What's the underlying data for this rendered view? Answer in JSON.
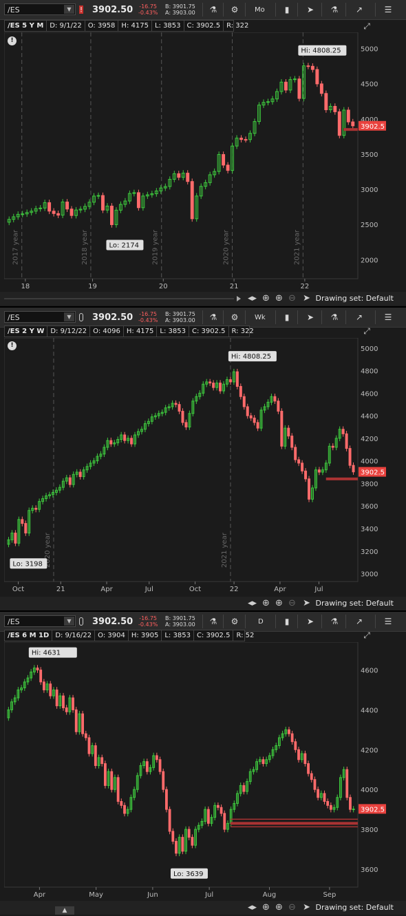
{
  "quote": {
    "price": "3902.50",
    "change": "-16.75",
    "change_pct": "-0.43%",
    "bid": "B: 3901.75",
    "ask": "A: 3903.00"
  },
  "drawing_set_label": "Drawing set: Default",
  "colors": {
    "up": "#3ec93e",
    "down": "#ff6b6b",
    "price_tag": "#e9423e",
    "bg": "#1b1b1b",
    "axis_text": "#bdbdbd"
  },
  "panels": [
    {
      "symbol": "/ES",
      "aggregation": "Mo",
      "info": [
        "/ES 5 Y M",
        "D: 9/1/22",
        "O: 3958",
        "H: 4175",
        "L: 3853",
        "C: 3902.5",
        "R: 322"
      ],
      "price_tag": "3902.5",
      "chart_data": {
        "type": "candlestick",
        "x_ticks": [
          "18",
          "19",
          "20",
          "21",
          "22"
        ],
        "year_markers": [
          "2017 year",
          "2018 year",
          "2019 year",
          "2020 year",
          "2021 year"
        ],
        "y_ticks": [
          "5000",
          "4500",
          "4000",
          "3500",
          "3000",
          "2500",
          "2000"
        ],
        "ylim": [
          1730,
          5230
        ],
        "hi_label": "Hi: 4808.25",
        "lo_label": "Lo: 2174",
        "last": 3902.5,
        "closes": [
          2573,
          2610,
          2645,
          2651,
          2671,
          2690,
          2725,
          2734,
          2811,
          2690,
          2656,
          2633,
          2820,
          2720,
          2628,
          2706,
          2718,
          2757,
          2817,
          2904,
          2912,
          2705,
          2762,
          2498,
          2704,
          2786,
          2834,
          2941,
          2953,
          2739,
          2905,
          2923,
          2937,
          2977,
          3019,
          3040,
          3142,
          3222,
          3170,
          3230,
          3111,
          2582,
          2905,
          3042,
          3095,
          3207,
          3254,
          3495,
          3344,
          3268,
          3615,
          3727,
          3708,
          3707,
          3795,
          3963,
          4197,
          4235,
          4245,
          4284,
          4389,
          4523,
          4410,
          4559,
          4568,
          4291,
          4754,
          4748,
          4702,
          4498,
          4362,
          4130,
          4179,
          4102,
          3766,
          4126,
          3958,
          3902
        ]
      }
    },
    {
      "symbol": "/ES",
      "aggregation": "Wk",
      "info": [
        "/ES 2 Y W",
        "D: 9/12/22",
        "O: 4096",
        "H: 4175",
        "L: 3853",
        "C: 3902.5",
        "R: 322"
      ],
      "price_tag": "3902.5",
      "chart_data": {
        "type": "candlestick",
        "x_ticks": [
          "Oct",
          "21",
          "Apr",
          "Jul",
          "Oct",
          "22",
          "Apr",
          "Jul"
        ],
        "year_markers": [
          "2020 year",
          "2021 year"
        ],
        "y_ticks": [
          "5000",
          "4800",
          "4600",
          "4400",
          "4200",
          "4000",
          "3800",
          "3600",
          "3400",
          "3200",
          "3000"
        ],
        "ylim": [
          2930,
          5090
        ],
        "hi_label": "Hi: 4808.25",
        "lo_label": "Lo: 3198",
        "last": 3902.5,
        "closes": [
          3300,
          3360,
          3270,
          3480,
          3445,
          3360,
          3560,
          3580,
          3570,
          3640,
          3665,
          3690,
          3700,
          3720,
          3740,
          3765,
          3820,
          3850,
          3790,
          3880,
          3900,
          3860,
          3920,
          3950,
          3980,
          4000,
          4040,
          4060,
          4120,
          4180,
          4150,
          4160,
          4190,
          4230,
          4180,
          4200,
          4150,
          4230,
          4260,
          4280,
          4330,
          4350,
          4390,
          4400,
          4420,
          4430,
          4470,
          4480,
          4510,
          4500,
          4440,
          4340,
          4300,
          4420,
          4530,
          4570,
          4600,
          4680,
          4700,
          4690,
          4650,
          4690,
          4620,
          4680,
          4720,
          4700,
          4790,
          4660,
          4570,
          4480,
          4400,
          4380,
          4340,
          4290,
          4450,
          4480,
          4520,
          4570,
          4530,
          4440,
          4130,
          4290,
          4220,
          4120,
          4010,
          3980,
          3910,
          3840,
          3660,
          3760,
          3920,
          3900,
          3920,
          3980,
          4130,
          4120,
          4200,
          4280,
          4240,
          4110,
          3960,
          3902
        ]
      }
    },
    {
      "symbol": "/ES",
      "aggregation": "D",
      "info": [
        "/ES 6 M 1D",
        "D: 9/16/22",
        "O: 3904",
        "H: 3905",
        "L: 3853",
        "C: 3902.5",
        "R: 52"
      ],
      "price_tag": "3902.5",
      "chart_data": {
        "type": "candlestick",
        "x_ticks": [
          "Apr",
          "May",
          "Jun",
          "Jul",
          "Aug",
          "Sep"
        ],
        "y_ticks": [
          "4600",
          "4400",
          "4200",
          "4000",
          "3800",
          "3600"
        ],
        "ylim": [
          3510,
          4740
        ],
        "hi_label": "Hi: 4631",
        "lo_label": "Lo: 3639",
        "last": 3902.5,
        "closes": [
          4400,
          4440,
          4460,
          4500,
          4510,
          4540,
          4560,
          4590,
          4610,
          4600,
          4540,
          4500,
          4530,
          4470,
          4500,
          4420,
          4470,
          4410,
          4390,
          4460,
          4400,
          4290,
          4380,
          4280,
          4260,
          4180,
          4220,
          4120,
          4160,
          4130,
          4020,
          4090,
          4000,
          4060,
          3940,
          3920,
          3880,
          3900,
          3960,
          4000,
          4070,
          4120,
          4140,
          4090,
          4110,
          4170,
          4150,
          4090,
          4000,
          3900,
          3790,
          3740,
          3680,
          3760,
          3690,
          3800,
          3760,
          3720,
          3800,
          3820,
          3840,
          3900,
          3830,
          3860,
          3920,
          3910,
          3880,
          3800,
          3830,
          3900,
          3930,
          3980,
          4020,
          3990,
          4040,
          4090,
          4100,
          4140,
          4150,
          4130,
          4150,
          4170,
          4200,
          4220,
          4260,
          4280,
          4300,
          4280,
          4240,
          4200,
          4150,
          4180,
          4130,
          4080,
          4050,
          4000,
          3960,
          3980,
          3940,
          3920,
          3900,
          3910,
          3960,
          4060,
          4100,
          3960,
          3900,
          3902
        ]
      }
    }
  ]
}
